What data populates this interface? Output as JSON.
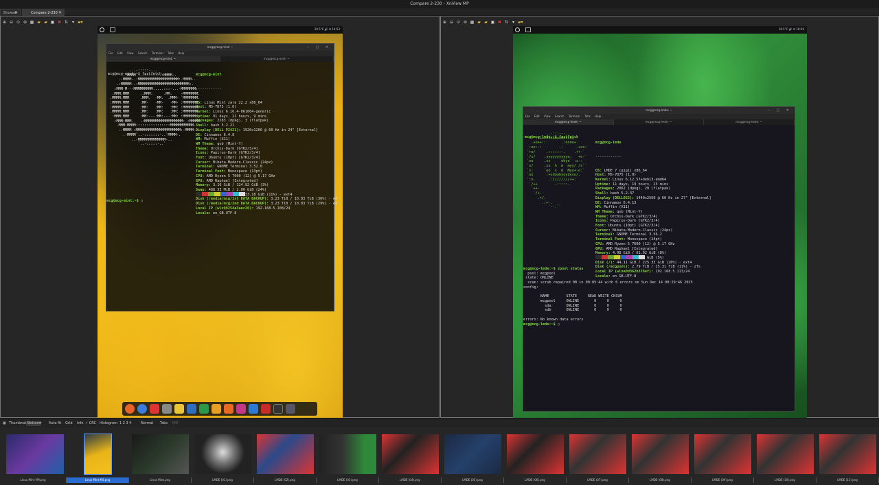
{
  "window": {
    "title": "Compare 2-230 - XnView MP"
  },
  "tabs": [
    {
      "label": "Browser"
    },
    {
      "label": "Compare 2-230"
    }
  ],
  "left": {
    "tray": "29.5°C  🔊  ⏻  14:53",
    "term": {
      "title": "mcg@mcg-mint: ~",
      "menu": [
        "File",
        "Edit",
        "View",
        "Search",
        "Terminal",
        "Tabs",
        "Help"
      ],
      "tabs": [
        "mcg@mcg-mint: ~",
        "mcg@mcg-mint: ~"
      ],
      "cmd": "mcg@mcg-mint:~$ fastfetch",
      "user": "mcg@mcg-mint",
      "sep": "------------",
      "info": [
        [
          "OS:",
          " Linux Mint zara 22.2 x86_64"
        ],
        [
          "Host:",
          " MS-7D75 (1.0)"
        ],
        [
          "Kernel:",
          " Linux 6.16.4-061604-generic"
        ],
        [
          "Uptime:",
          " 91 days, 21 hours, 9 mins"
        ],
        [
          "Packages:",
          " 2283 (dpkg), 3 (flatpak)"
        ],
        [
          "Shell:",
          " bash 5.2.21"
        ],
        [
          "Display (DELL P2421):",
          " 1920x1200 @ 60 Hz in 24\" [External]"
        ],
        [
          "DE:",
          " Cinnamon 6.4.8"
        ],
        [
          "WM:",
          " Muffin (X11)"
        ],
        [
          "WM Theme:",
          " qob (Mint-Y)"
        ],
        [
          "Theme:",
          " Orchis-Dark [GTK2/3/4]"
        ],
        [
          "Icons:",
          " Papirus-Dark [GTK2/3/4]"
        ],
        [
          "Font:",
          " Ubuntu (10pt) [GTK2/3/4]"
        ],
        [
          "Cursor:",
          " Bibata-Modern-Classic (24px)"
        ],
        [
          "Terminal:",
          " GNOME Terminal 3.52.0"
        ],
        [
          "Terminal Font:",
          " Monospace (13pt)"
        ],
        [
          "CPU:",
          " AMD Ryzen 5 7600 (12) @ 5.17 GHz"
        ],
        [
          "GPU:",
          " AMD Raphael [Integrated]"
        ],
        [
          "Memory:",
          " 3.16 GiB / 124.92 GiB (3%)"
        ],
        [
          "Swap:",
          " 488.33 MiB / 2.00 GiB (24%)"
        ],
        [
          "Disk (/):",
          " 26.34 GiB / 233.18 GiB (11%) - ext4"
        ],
        [
          "Disk (/media/mcg/1st DATA BACKUP):",
          " 3.23 TiB / 10.83 TiB (30%) - e4"
        ],
        [
          "Disk (/media/mcg/2nd DATA BACKUP):",
          " 3.23 TiB / 10.83 TiB (29%) - e4"
        ],
        [
          "Local IP (wlx98254a3aec20):",
          " 192.168.5.108/24"
        ],
        [
          "Locale:",
          " en_GB.UTF-8"
        ]
      ],
      "logo": [
        "          ...-:::::-...",
        "       .-MMMM`..-::::::-.:MMMM-.",
        "     .-MMMM-.:MMMMMMMMMMMMMMMMMMM:.MMMM-.",
        "    .:MMMMM-.:MMMMMMMMMMMMMMMMMMMMMMMM:.",
        "   :MMM-M---MMMMMMMMM.....:::-...-MMMMMMM:",
        "  :MMM:MMM     .:MMM:     .MM.    -MMMMMMM:",
        " .MMMM:MMM     .MMM.  -MM.  .MMM- `MMMMMMM.",
        " :MMMM:MMM     :MM-   -MM-   -MM- :MMMMMMM:",
        " :MMMM:MMM     :MM:   :MM:   :MM: :MMMMMMM:",
        " .MMMM:MMM     :MM:   :MM:   :MM: :MMMMMMM.",
        "  :MMM:MMM     :MM:---:MM:---:MM: :MMMMMM:",
        "   :MMM:MMM.   .:MMMMMMMMMMMMMMMMMM: :MMMMM:",
        "    .MMM:MMMM::::::::::::::::MMMMMMMMMMM.",
        "     .-MMMM-:MMMMMMMMMMMMMMMMMMMMM:-MMMM-.",
        "       .-MMMM`..-:::::::-..`MMMM-.",
        "           ..-MMMMMMMMMMMMM-..",
        "              `..-:::::-..`"
      ],
      "prompt": "mcg@mcg-mint:~$ "
    }
  },
  "right": {
    "tray": "18.5°C  🔊  ⏻  18:20",
    "term": {
      "title": "mcg@mcg-lmde: ~",
      "menu": [
        "File",
        "Edit",
        "View",
        "Search",
        "Terminal",
        "Tabs",
        "Help"
      ],
      "tabs": [
        "mcg@mcg-lmde: ~",
        "mcg@mcg-lmde: ~",
        "mcg@mcg-lmde: ~"
      ],
      "cmd": "mcg@mcg-lmde:~$ fastfetch",
      "user": "mcg@mcg-lmde",
      "sep": "------------",
      "info": [
        [
          "OS:",
          " LMDE 7 (gigi) x86_64"
        ],
        [
          "Host:",
          " MS-7D75 (1.0)"
        ],
        [
          "Kernel:",
          " Linux 6.12.57+deb13-amd64"
        ],
        [
          "Uptime:",
          " 11 days, 19 hours, 23 mins"
        ],
        [
          "Packages:",
          " 2062 (dpkg), 20 (flatpak)"
        ],
        [
          "Shell:",
          " bash 5.2.37"
        ],
        [
          "Display (DELL052):",
          " 1440x2560 @ 60 Hz in 27\" [External]"
        ],
        [
          "DE:",
          " Cinnamon 6.4.13"
        ],
        [
          "WM:",
          " Muffin (X11)"
        ],
        [
          "WM Theme:",
          " qob (Mint-Y)"
        ],
        [
          "Theme:",
          " Orchis-Dark [GTK2/3/4]"
        ],
        [
          "Icons:",
          " Papirus-Dark [GTK2/3/4]"
        ],
        [
          "Font:",
          " Ubuntu (10pt) [GTK2/3/4]"
        ],
        [
          "Cursor:",
          " Bibata-Modern-Classic (24px)"
        ],
        [
          "Terminal:",
          " GNOME Terminal 3.56.2"
        ],
        [
          "Terminal Font:",
          " Monospace (14pt)"
        ],
        [
          "CPU:",
          " AMD Ryzen 5 7600 (12) @ 5.17 GHz"
        ],
        [
          "GPU:",
          " AMD Raphael [Integrated]"
        ],
        [
          "Memory:",
          " 4.98 GiB / 61.92 GiB (8%)"
        ],
        [
          "Swap:",
          " 424.31 MiB / 8.20 GiB (5%)"
        ],
        [
          "Disk (/):",
          " 44.11 GiB / 225.33 GiB (20%) - ext4"
        ],
        [
          "Disk (/mcgpool):",
          " 2.79 TiB / 25.31 TiB (11%) - zfs"
        ],
        [
          "Local IP (wlxe0d362b378ef):",
          " 192.168.5.113/24"
        ],
        [
          "Locale:",
          " en_GB.UTF-8"
        ]
      ],
      "logo": [
        "          ..-:::---..",
        "     .:+++++ooooooossoo:.",
        "   .+o++::.      .:oooo+.",
        "  :oo:.:        .:      -+oo:",
        " `+o/     .::::::-.    .++-`",
        " `/s/    .yyyyyyyyyyo:   +o-`",
        " `so     .ss     ohyo` :s-:",
        " `s/     .ss  h  m  myy/ /s``",
        " `s:     `oo  s  m  Myy+-o:`",
        " `oo      :+sdoohyoydyso/.",
        " `:o.      .:////////++:",
        "  `/++        -:::::-",
        "   `++-",
        "    `/+-",
        "      .+/.",
        "        .:+-.",
        "           `--.``"
      ],
      "zpool": [
        "mcg@mcg-lmde:~$ zpool status",
        "  pool: mcgpool",
        " state: ONLINE",
        "  scan: scrub repaired 0B in 00:05:44 with 0 errors on Sun Dec 14 00:29:46 2025",
        "config:",
        "",
        "        NAME        STATE     READ WRITE CKSUM",
        "        mcgpool     ONLINE       0     0     0",
        "          sda       ONLINE       0     0     0",
        "          sdb       ONLINE       0     0     0",
        "",
        "errors: No known data errors"
      ],
      "prompt": "mcg@mcg-lmde:~$ "
    }
  },
  "bottombar": {
    "thumbnails": "Thumbnails",
    "position": "Bottom",
    "autofit": "Auto fit",
    "grid": "Grid",
    "info": "Info",
    "crc": "✓ CRC",
    "histogram": "Histogram",
    "nums": "1  2  3  4",
    "mode": "Normal",
    "tabs": "Tabs",
    "count": "0/0"
  },
  "thumbnails": [
    "Linux Mint VM.png",
    "Linux Mint MS.png",
    "Linux Mint.png",
    "LMDE (01).png",
    "LMDE (02).png",
    "LMDE (03).png",
    "LMDE (04).png",
    "LMDE (05).png",
    "LMDE (06).png",
    "LMDE (07).png",
    "LMDE (08).png",
    "LMDE (09).png",
    "LMDE (10).png",
    "LMDE (11).png"
  ],
  "swatch_colors": [
    "#2b2b2b",
    "#c33",
    "#6a3",
    "#cc3",
    "#36c",
    "#a4a",
    "#3bc",
    "#ddd"
  ]
}
